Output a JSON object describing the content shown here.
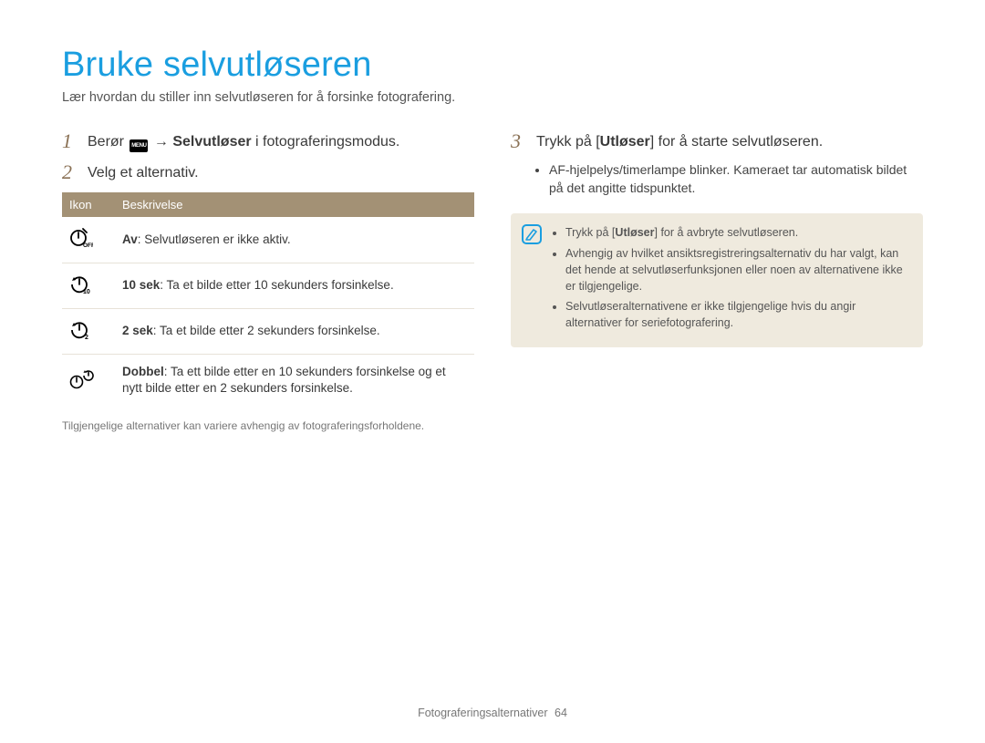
{
  "title": "Bruke selvutløseren",
  "subtitle": "Lær hvordan du stiller inn selvutløseren for å forsinke fotografering.",
  "left": {
    "step1": {
      "num": "1",
      "prefix": "Berør ",
      "menu_icon_label": "MENU",
      "arrow": " → ",
      "bold": "Selvutløser",
      "suffix": " i fotograferingsmodus."
    },
    "step2": {
      "num": "2",
      "text": "Velg et alternativ."
    },
    "table": {
      "head_icon": "Ikon",
      "head_desc": "Beskrivelse",
      "rows": [
        {
          "bold": "Av",
          "rest": ": Selvutløseren er ikke aktiv."
        },
        {
          "bold": "10 sek",
          "rest": ": Ta et bilde etter 10 sekunders forsinkelse."
        },
        {
          "bold": "2 sek",
          "rest": ": Ta et bilde etter 2 sekunders forsinkelse."
        },
        {
          "bold": "Dobbel",
          "rest": ": Ta ett bilde etter en 10 sekunders forsinkelse og et nytt bilde etter en 2 sekunders forsinkelse."
        }
      ]
    },
    "footnote": "Tilgjengelige alternativer kan variere avhengig av fotograferingsforholdene."
  },
  "right": {
    "step3": {
      "num": "3",
      "prefix": "Trykk på [",
      "bold": "Utløser",
      "suffix": "] for å starte selvutløseren."
    },
    "bullets": [
      "AF-hjelpelys/timerlampe blinker. Kameraet tar automatisk bildet på det angitte tidspunktet."
    ],
    "note": {
      "items": [
        {
          "pre": "Trykk på [",
          "bold": "Utløser",
          "post": "] for å avbryte selvutløseren."
        },
        {
          "text": "Avhengig av hvilket ansiktsregistreringsalternativ du har valgt, kan det hende at selvutløserfunksjonen eller noen av alternativene ikke er tilgjengelige."
        },
        {
          "text": "Selvutløseralternativene er ikke tilgjengelige hvis du angir alternativer for seriefotografering."
        }
      ]
    }
  },
  "footer": {
    "section": "Fotograferingsalternativer",
    "page": "64"
  }
}
